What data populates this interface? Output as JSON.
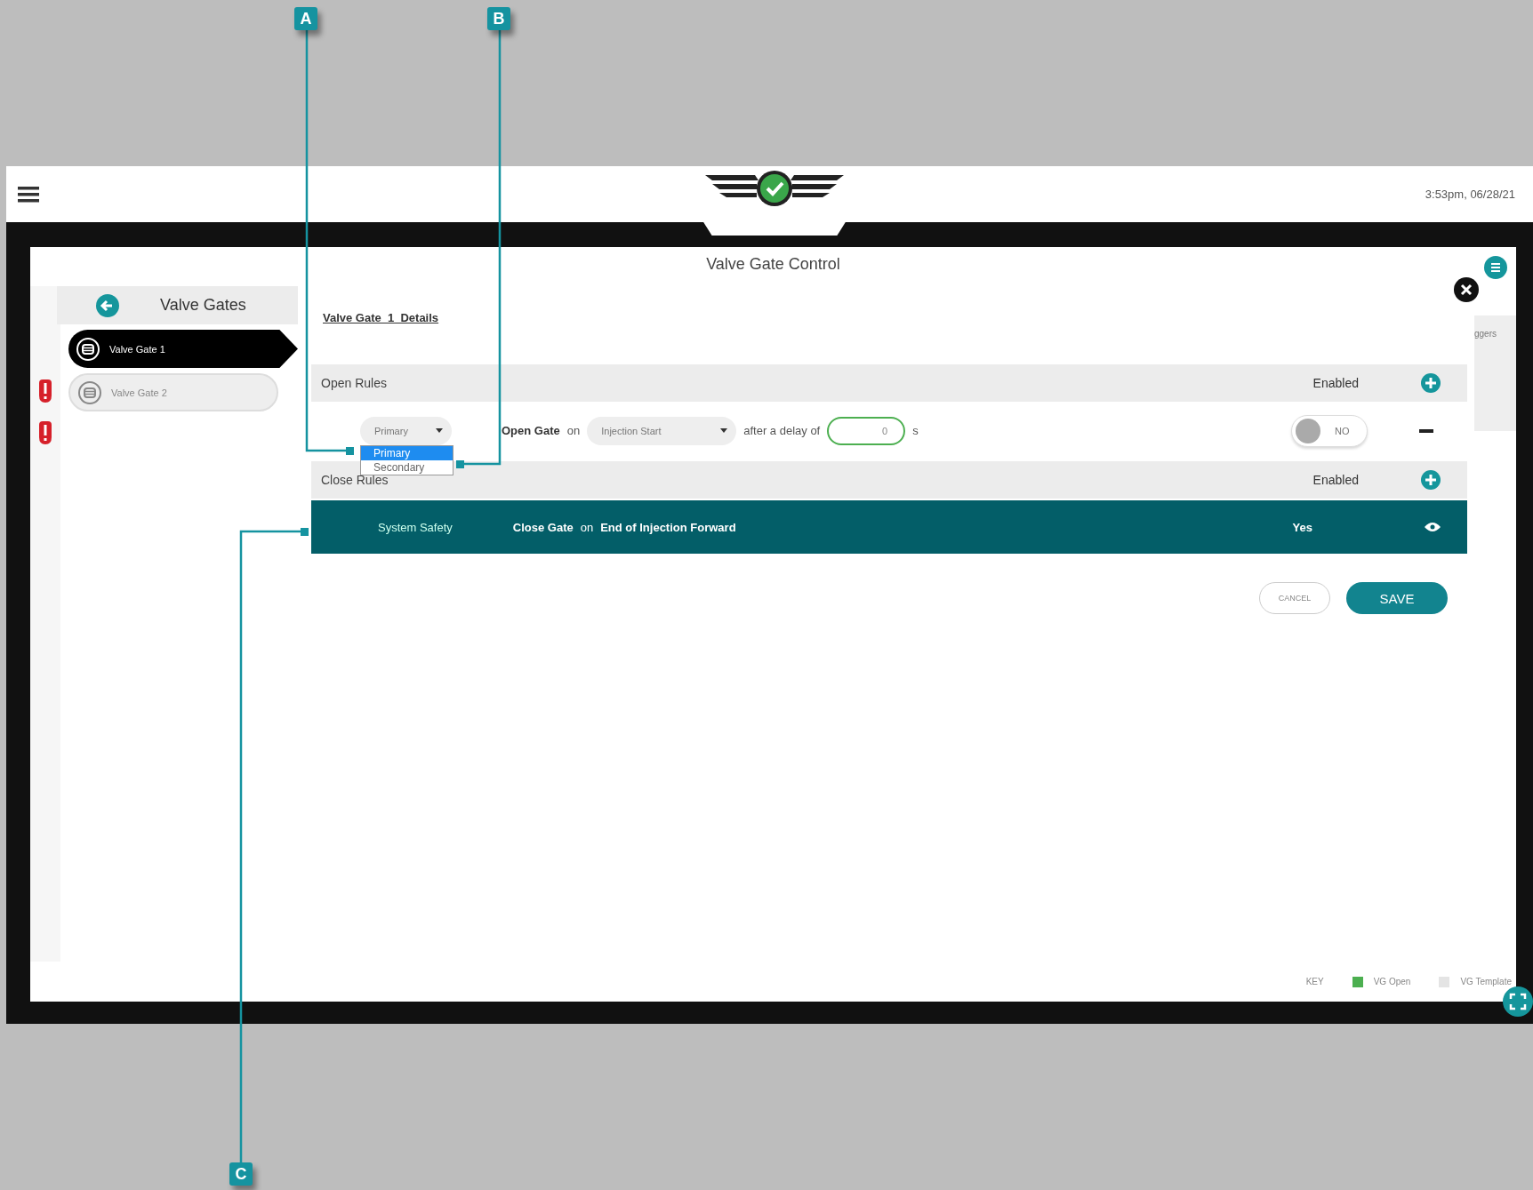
{
  "header": {
    "time": "3:53pm, 06/28/21"
  },
  "dialog": {
    "title": "Valve Gate Control",
    "behind_text": "ggers"
  },
  "sidebar": {
    "title": "Valve Gates",
    "items": [
      {
        "label": "Valve Gate 1",
        "selected": true
      },
      {
        "label": "Valve Gate 2",
        "selected": false
      }
    ],
    "status_column": [
      {
        "alert": false
      },
      {
        "alert": true
      },
      {
        "alert": true
      }
    ]
  },
  "details_link": "Valve Gate  1  Details",
  "open_rules": {
    "title": "Open Rules",
    "enabled_heading": "Enabled",
    "rules": [
      {
        "priority": {
          "value": "Primary",
          "expanded": true,
          "options": [
            {
              "label": "Primary",
              "selected": true
            },
            {
              "label": "Secondary",
              "selected": false
            }
          ]
        },
        "action": "Open Gate",
        "on": "on",
        "trigger": "Injection Start",
        "delay_label": "after a delay of",
        "delay": "0",
        "unit": "s",
        "enabled": false,
        "enabled_label": "NO"
      }
    ]
  },
  "close_rules": {
    "title": "Close Rules",
    "enabled_heading": "Enabled",
    "rules": [
      {
        "name": "System Safety",
        "action": "Close Gate",
        "on": "on",
        "trigger": "End of Injection Forward",
        "enabled_label": "Yes",
        "selected": true
      }
    ]
  },
  "buttons": {
    "cancel": "CANCEL",
    "save": "SAVE"
  },
  "key": {
    "title": "KEY",
    "items": [
      {
        "label": "VG Open",
        "color": "#4caf50"
      },
      {
        "label": "VG Template",
        "color": "#e4e4e4"
      }
    ]
  },
  "callouts": [
    {
      "label": "A"
    },
    {
      "label": "B"
    },
    {
      "label": "C"
    }
  ]
}
